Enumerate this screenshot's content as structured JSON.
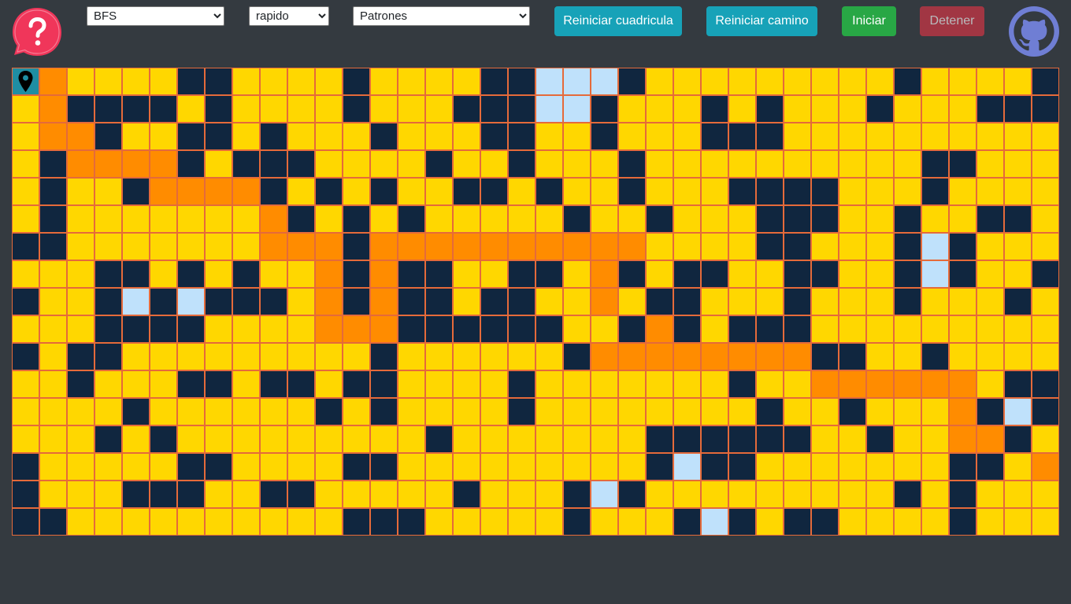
{
  "controls": {
    "algorithm": {
      "selected": "BFS",
      "options": [
        "BFS"
      ]
    },
    "speed": {
      "selected": "rapido",
      "options": [
        "rapido"
      ]
    },
    "pattern": {
      "selected": "Patrones",
      "options": [
        "Patrones"
      ]
    }
  },
  "buttons": {
    "reset_grid": "Reiniciar cuadricula",
    "reset_path": "Reiniciar camino",
    "start": "Iniciar",
    "stop": "Detener"
  },
  "colors": {
    "background": "#343a40",
    "open": "#ffd700",
    "wall": "#10263f",
    "visited": "#bfe1fb",
    "path": "#ff8c00",
    "endpoint": "#1f8ea3",
    "cell_border": "#e56a3a",
    "help": "#f0365a",
    "github": "#6f7ed4"
  },
  "icons": {
    "help": "question-speech-bubble-icon",
    "github": "github-octocat-icon",
    "start_node": "map-pin-icon",
    "target_node": "target-icon"
  },
  "grid": {
    "cols": 38,
    "rows": 17,
    "legend": {
      ".": "open",
      "#": "wall",
      "v": "visited",
      "p": "path",
      "S": "start",
      "T": "target"
    },
    "cells": [
      "Sp....##....#....##vvv#.........#....#v##.",
      ".p####.#....#...###vv#...#.#...#...###..",
      ".pp#..##.#...#...##..#...###..........#",
      ".#pppp#.###....#..#...#..........##...#.#",
      ".#..#pppp#.#.#..##.#..#...####...#....",
      ".#.......p#.#.#.....#..#...###..#..##.#",
      "##.......ppp#pppppppppp....##...#v#.....",
      "...##.#.#..p#p##..##.p#.##..##..#v#..#..",
      "#..#v#v###.p#p##.##..p.##...#...#...#...",
      "...####....ppp######..#p#.###...........##v",
      "#.##.........#......#pppppppp##..#....#vv",
      "..#...##.##.##....#.......#..pppppp.###v##",
      "....#......#.#....#........#..#...p#v##..",
      "...#.#.........#.......######..#..pp#....",
      "#.....##....##.........#v##.......##.pppppp",
      "#...###..##.....#...#v#.........#.#.....p",
      "##..........###.....#...#v#.##....#.....T"
    ]
  }
}
